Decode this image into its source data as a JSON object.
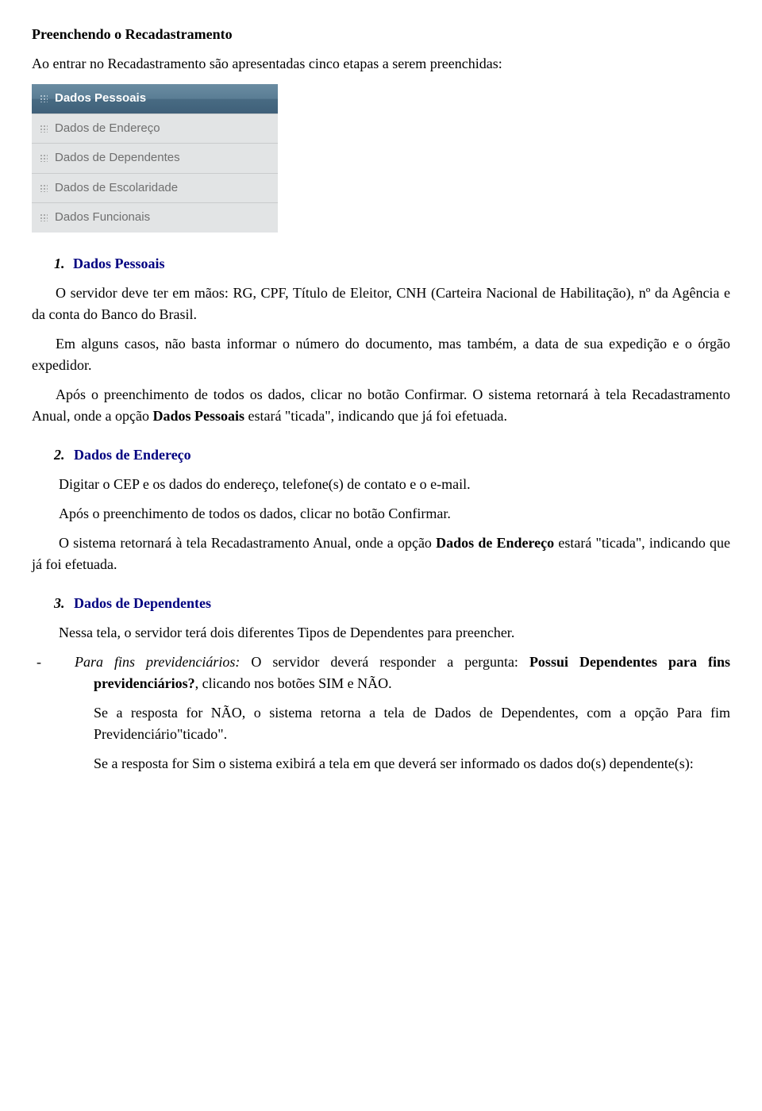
{
  "heading": "Preenchendo o Recadastramento",
  "intro": "Ao entrar no Recadastramento são apresentadas cinco etapas a serem preenchidas:",
  "menu": {
    "items": [
      "Dados Pessoais",
      "Dados de Endereço",
      "Dados de Dependentes",
      "Dados de Escolaridade",
      "Dados Funcionais"
    ]
  },
  "s1": {
    "num": "1.",
    "title": "Dados Pessoais",
    "p1a": "O servidor deve ter em mãos: RG, CPF, Título de Eleitor, CNH (Carteira Nacional de Habilitação), nº da Agência e da conta do Banco do Brasil.",
    "p2": "Em alguns casos, não basta informar o número do documento, mas também, a data de sua expedição e o órgão expedidor.",
    "p3a": "Após o preenchimento de todos os dados, clicar no botão Confirmar. O sistema retornará à tela Recadastramento Anual, onde a opção ",
    "p3b": "Dados Pessoais",
    "p3c": " estará \"ticada\", indicando que já foi efetuada."
  },
  "s2": {
    "num": "2.",
    "title": "Dados de Endereço",
    "p1": "Digitar o CEP e os dados do endereço, telefone(s) de contato e o e-mail.",
    "p2": "Após o preenchimento de todos os dados, clicar no botão Confirmar.",
    "p3a": "O sistema retornará à tela Recadastramento Anual, onde a opção ",
    "p3b": "Dados de Endereço",
    "p3c": " estará \"ticada\", indicando que já foi efetuada."
  },
  "s3": {
    "num": "3.",
    "title": "Dados de Dependentes",
    "p1": "Nessa tela, o servidor terá dois diferentes Tipos de Dependentes para preencher.",
    "bullet": "-",
    "b1a": "Para fins previdenciários:",
    "b1b": " O servidor deverá responder a pergunta: ",
    "b1c": "Possui Dependentes para fins previdenciários?",
    "b1d": ", clicando nos botões SIM e NÃO.",
    "b2": "Se a resposta for NÃO, o sistema retorna a tela de Dados de Dependentes, com a opção Para fim Previdenciário\"ticado\".",
    "b3": "Se a resposta for Sim o sistema exibirá a tela em que deverá ser informado os dados do(s) dependente(s):"
  }
}
